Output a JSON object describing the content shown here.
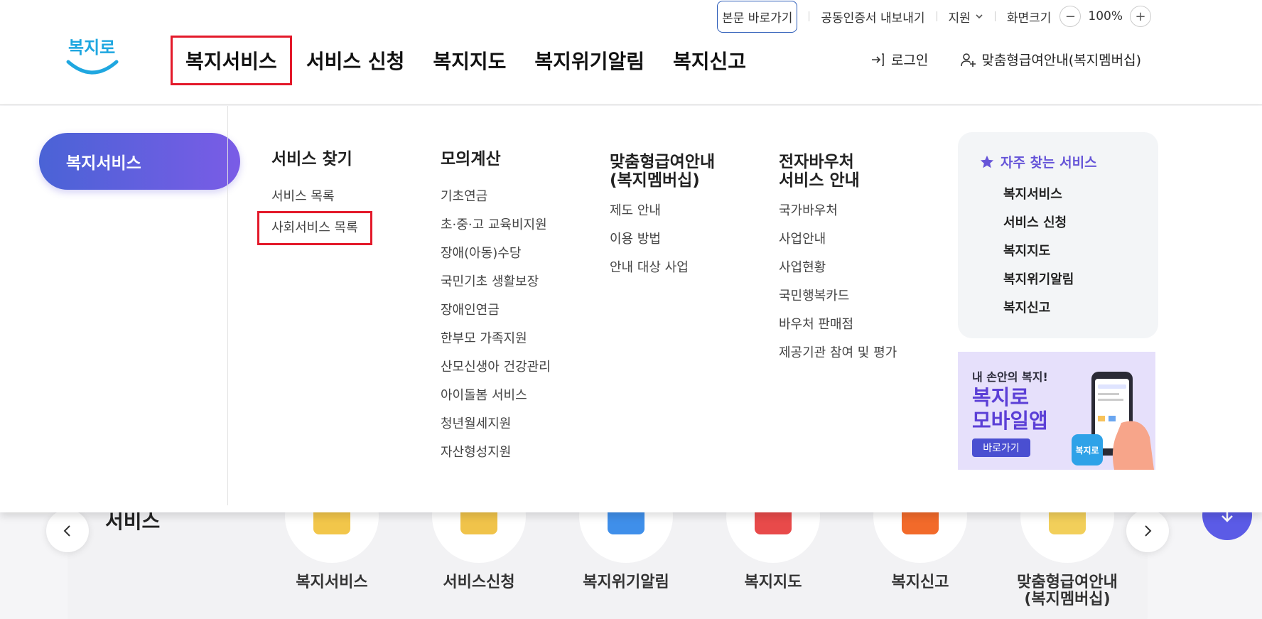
{
  "utility": {
    "skip_link": "본문 바로가기",
    "cert_export": "공동인증서 내보내기",
    "support": "지원",
    "zoom_label": "화면크기",
    "zoom_minus": "−",
    "zoom_value": "100%",
    "zoom_plus": "+"
  },
  "logo": {
    "text": "복지로"
  },
  "gnb": {
    "items": [
      "복지서비스",
      "서비스 신청",
      "복지지도",
      "복지위기알림",
      "복지신고"
    ]
  },
  "member": {
    "login": "로그인",
    "membership": "맞춤형급여안내(복지멤버십)"
  },
  "mega": {
    "active_pill": "복지서비스",
    "columns": [
      {
        "title": "서비스 찾기",
        "items": [
          "서비스 목록",
          "사회서비스 목록"
        ]
      },
      {
        "title": "모의계산",
        "items": [
          "기초연금",
          "초·중·고 교육비지원",
          "장애(아동)수당",
          "국민기초 생활보장",
          "장애인연금",
          "한부모 가족지원",
          "산모신생아 건강관리",
          "아이돌봄 서비스",
          "청년월세지원",
          "자산형성지원"
        ]
      },
      {
        "title": "맞춤형급여안내\n(복지멤버십)",
        "items": [
          "제도 안내",
          "이용 방법",
          "안내 대상 사업"
        ]
      },
      {
        "title": "전자바우처\n서비스 안내",
        "items": [
          "국가바우처",
          "사업안내",
          "사업현황",
          "국민행복카드",
          "바우처 판매점",
          "제공기관 참여 및 평가"
        ]
      }
    ],
    "favorites": {
      "title": "자주 찾는 서비스",
      "items": [
        "복지서비스",
        "서비스 신청",
        "복지지도",
        "복지위기알림",
        "복지신고"
      ]
    },
    "banner": {
      "subtitle": "내 손안의 복지!",
      "title": "복지로\n모바일앱",
      "button": "바로가기",
      "app_icon_text": "복지로"
    }
  },
  "background_page": {
    "section_title": "서비스",
    "services": [
      {
        "label": "복지서비스",
        "color": "#f2c64a"
      },
      {
        "label": "서비스신청",
        "color": "#f0c34a"
      },
      {
        "label": "복지위기알림",
        "color": "#3f8fea"
      },
      {
        "label": "복지지도",
        "color": "#e84a4a"
      },
      {
        "label": "복지신고",
        "color": "#f26a2a"
      },
      {
        "label": "맞춤형급여안내\n(복지멤버십)",
        "color": "#f2cf5a"
      }
    ]
  },
  "colors": {
    "accent_purple": "#6655d8",
    "highlight_red": "#e3192a",
    "logo_blue": "#1fa7e0"
  }
}
